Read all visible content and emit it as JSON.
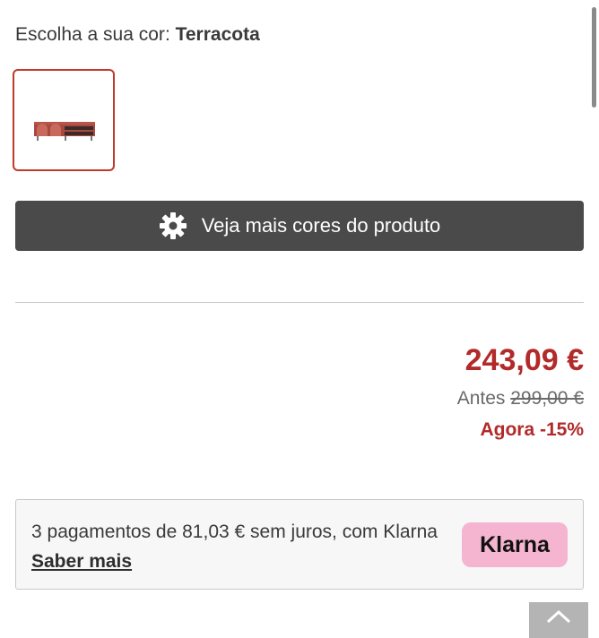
{
  "color_selector": {
    "prefix": "Escolha a sua cor",
    "selected_color": "Terracota"
  },
  "more_colors_button": {
    "label": "Veja mais cores do produto",
    "icon": "gear-icon"
  },
  "pricing": {
    "current_price": "243,09 €",
    "before_label": "Antes",
    "old_price": "299,00 €",
    "discount": "Agora -15%"
  },
  "klarna": {
    "text": "3 pagamentos de 81,03 € sem juros, com Klarna",
    "link": "Saber mais",
    "logo_text": "Klarna",
    "logo_color": "#f5b4cf"
  },
  "colors": {
    "accent": "#b22a2a",
    "button_bg": "#4a4a4a"
  }
}
